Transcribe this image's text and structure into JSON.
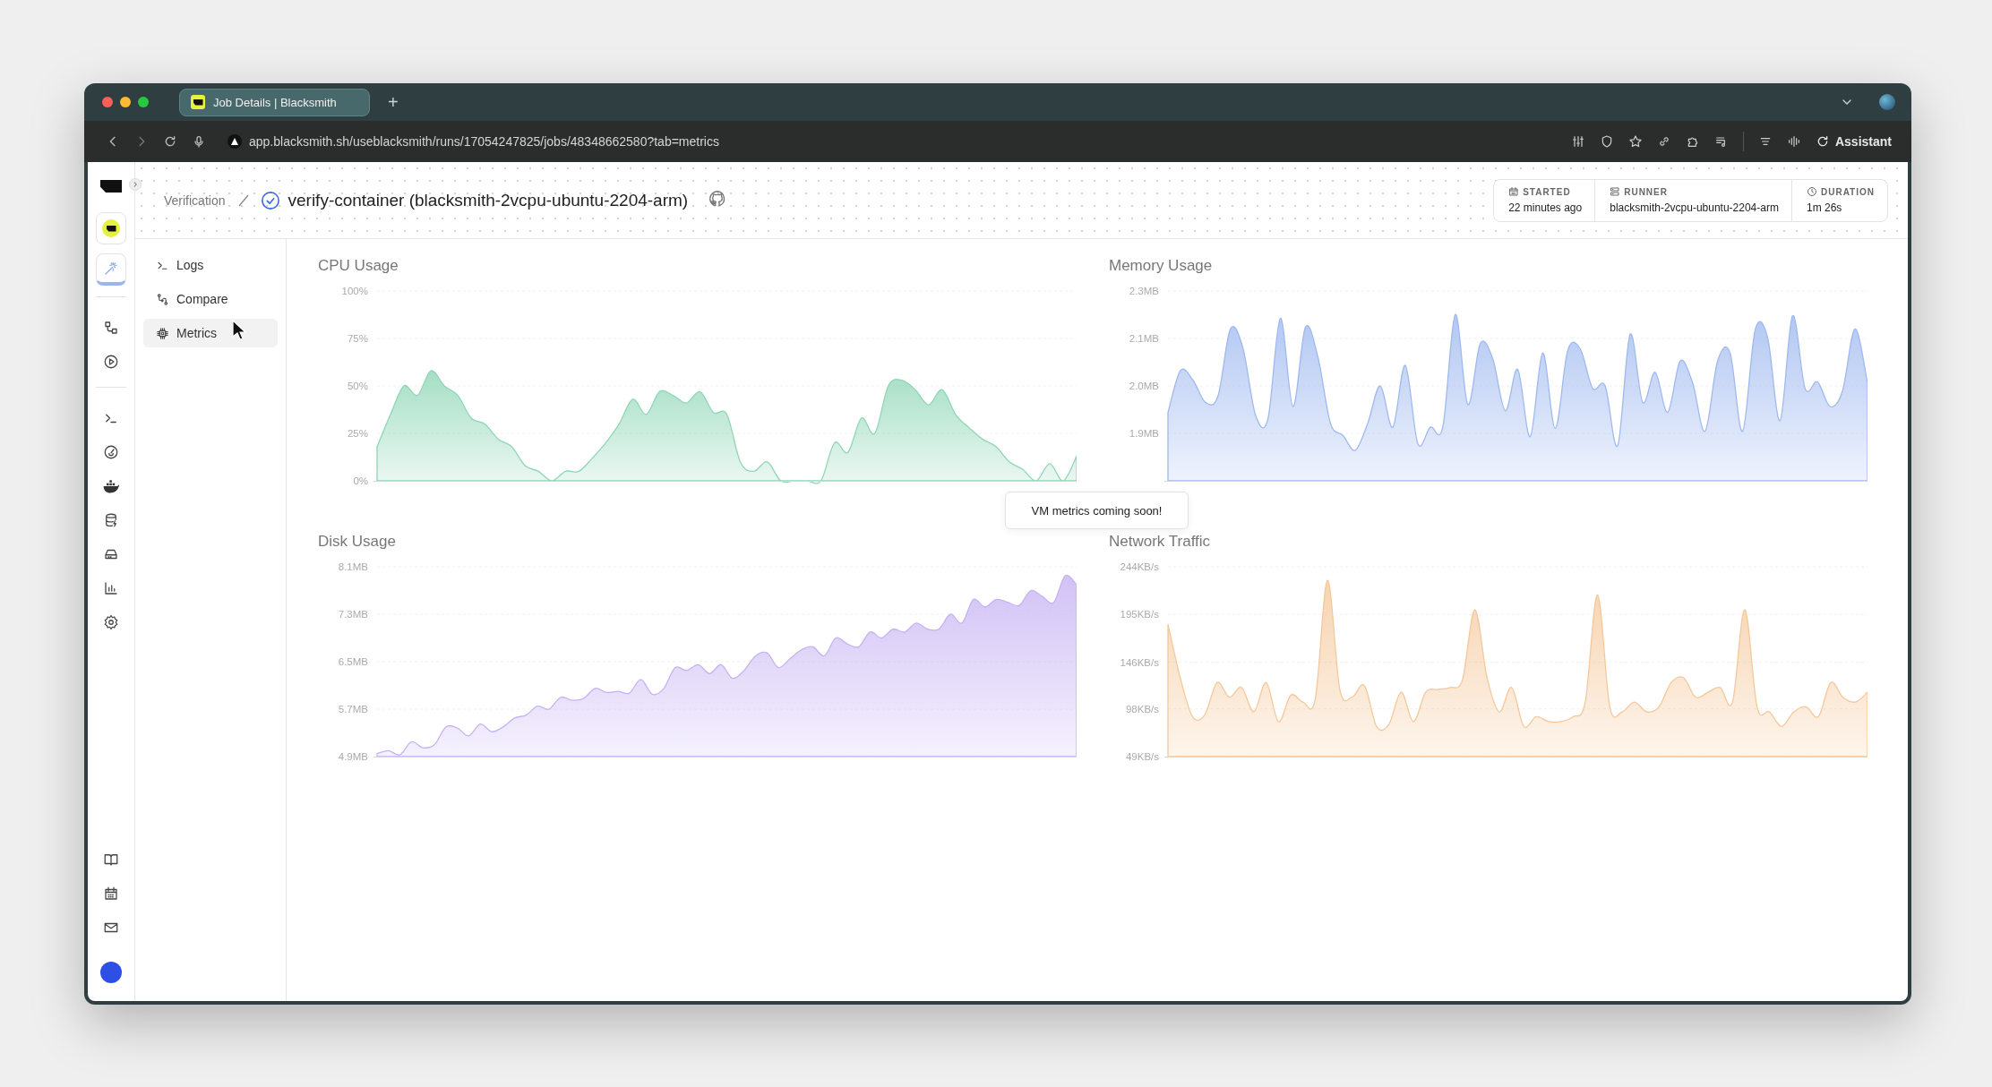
{
  "browser": {
    "tabs": [
      {
        "title": "Job Details | Blacksmith",
        "selected": true
      }
    ],
    "new_tab": "+",
    "url": "app.blacksmith.sh/useblacksmith/runs/17054247825/jobs/48348662580?tab=metrics",
    "assistant": "Assistant"
  },
  "rail": {
    "apps": [
      {
        "selected": false
      },
      {
        "selected": true
      }
    ]
  },
  "header": {
    "breadcrumb": "Verification",
    "job_title": "verify-container (blacksmith-2vcpu-ubuntu-2204-arm)",
    "info": [
      {
        "kind": "calendar",
        "label": "STARTED",
        "value": "22 minutes ago"
      },
      {
        "kind": "server",
        "label": "RUNNER",
        "value": "blacksmith-2vcpu-ubuntu-2204-arm"
      },
      {
        "kind": "clock",
        "label": "DURATION",
        "value": "1m 26s"
      }
    ]
  },
  "nav": [
    {
      "kind": "terminal",
      "label": "Logs",
      "selected": false
    },
    {
      "kind": "compare",
      "label": "Compare",
      "selected": false
    },
    {
      "kind": "chip",
      "label": "Metrics",
      "selected": true
    }
  ],
  "charts": [
    {
      "chart_data": {
        "type": "area",
        "title": "CPU Usage",
        "grid": true,
        "ylim": [
          0,
          100
        ],
        "yticks": [
          {
            "value": 0,
            "label": "0%"
          },
          {
            "value": 25,
            "label": "25%"
          },
          {
            "value": 50,
            "label": "50%"
          },
          {
            "value": 75,
            "label": "75%"
          },
          {
            "value": 100,
            "label": "100%"
          }
        ],
        "series": [
          {
            "color": "#8fd6b6",
            "values": [
              18,
              35,
              50,
              45,
              58,
              50,
              45,
              33,
              30,
              22,
              18,
              8,
              5,
              0,
              5,
              5,
              12,
              20,
              30,
              43,
              35,
              47,
              45,
              41,
              47,
              36,
              35,
              10,
              5,
              10,
              0,
              0,
              0,
              0,
              20,
              15,
              33,
              25,
              50,
              53,
              48,
              40,
              48,
              35,
              28,
              22,
              18,
              10,
              6,
              0,
              9,
              0,
              13
            ]
          }
        ]
      }
    },
    {
      "chart_data": {
        "type": "area",
        "title": "Memory Usage",
        "grid": true,
        "ylim": [
          1.8,
          2.26
        ],
        "yticks": [
          {
            "value": 1.915,
            "label": "1.9MB"
          },
          {
            "value": 2.03,
            "label": "2.0MB"
          },
          {
            "value": 2.145,
            "label": "2.1MB"
          },
          {
            "value": 2.26,
            "label": "2.3MB"
          }
        ],
        "series": [
          {
            "color": "#9fb9ef",
            "values": [
              1.966,
              2.067,
              2.044,
              1.99,
              2.005,
              2.168,
              2.122,
              1.96,
              1.95,
              2.194,
              1.98,
              2.172,
              2.1,
              1.94,
              1.91,
              1.874,
              1.94,
              2.03,
              1.93,
              2.08,
              1.89,
              1.93,
              1.93,
              2.203,
              1.985,
              2.133,
              2.096,
              1.97,
              2.07,
              1.907,
              2.11,
              1.927,
              2.116,
              2.12,
              2.024,
              2.03,
              1.885,
              2.155,
              1.99,
              2.063,
              1.966,
              2.09,
              2.037,
              1.92,
              2.09,
              2.11,
              1.92,
              2.165,
              2.148,
              1.946,
              2.2,
              2.024,
              2.04,
              1.98,
              2.018,
              2.168,
              2.037
            ]
          }
        ]
      }
    },
    {
      "chart_data": {
        "type": "area",
        "title": "Disk Usage",
        "grid": true,
        "ylim": [
          4.9,
          8.1
        ],
        "yticks": [
          {
            "value": 4.9,
            "label": "4.9MB"
          },
          {
            "value": 5.7,
            "label": "5.7MB"
          },
          {
            "value": 6.5,
            "label": "6.5MB"
          },
          {
            "value": 7.3,
            "label": "7.3MB"
          },
          {
            "value": 8.1,
            "label": "8.1MB"
          }
        ],
        "series": [
          {
            "color": "#c6b2f3",
            "values": [
              4.95,
              5.0,
              4.93,
              5.15,
              5.05,
              5.1,
              5.4,
              5.38,
              5.25,
              5.45,
              5.32,
              5.4,
              5.55,
              5.6,
              5.75,
              5.7,
              5.9,
              5.85,
              5.88,
              6.05,
              5.98,
              6.0,
              5.97,
              6.2,
              5.95,
              6.05,
              6.4,
              6.35,
              6.45,
              6.3,
              6.45,
              6.22,
              6.35,
              6.6,
              6.65,
              6.4,
              6.55,
              6.7,
              6.75,
              6.6,
              6.9,
              6.8,
              6.75,
              7.0,
              6.9,
              7.05,
              7.0,
              7.15,
              7.05,
              7.05,
              7.3,
              7.15,
              7.55,
              7.42,
              7.55,
              7.5,
              7.45,
              7.7,
              7.6,
              7.5,
              7.95,
              7.8
            ]
          }
        ]
      }
    },
    {
      "chart_data": {
        "type": "area",
        "title": "Network Traffic",
        "grid": true,
        "ylim": [
          49,
          244
        ],
        "yticks": [
          {
            "value": 49,
            "label": "49KB/s"
          },
          {
            "value": 98,
            "label": "98KB/s"
          },
          {
            "value": 146,
            "label": "146KB/s"
          },
          {
            "value": 195,
            "label": "195KB/s"
          },
          {
            "value": 244,
            "label": "244KB/s"
          }
        ],
        "series": [
          {
            "color": "#f5c89b",
            "values": [
              185,
              130,
              90,
              92,
              125,
              110,
              120,
              95,
              125,
              85,
              112,
              105,
              108,
              230,
              118,
              110,
              122,
              80,
              82,
              115,
              85,
              115,
              118,
              120,
              128,
              200,
              130,
              95,
              120,
              80,
              90,
              85,
              85,
              90,
              105,
              215,
              100,
              95,
              105,
              95,
              100,
              125,
              130,
              110,
              115,
              120,
              105,
              200,
              100,
              95,
              80,
              95,
              100,
              90,
              125,
              110,
              105,
              115
            ]
          }
        ]
      }
    }
  ],
  "tooltip": "VM metrics coming soon!"
}
